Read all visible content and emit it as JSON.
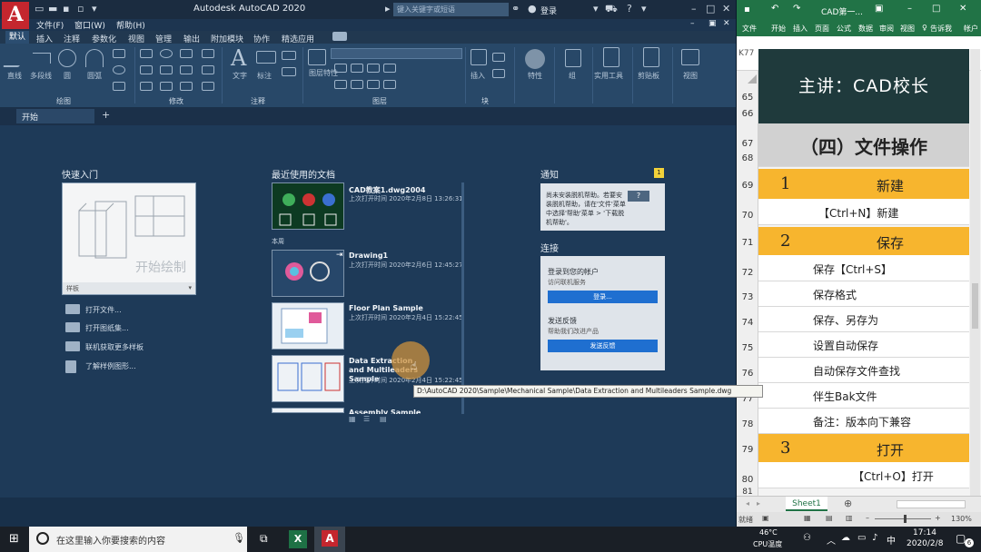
{
  "autocad": {
    "title": "Autodesk AutoCAD 2020",
    "search_placeholder": "键入关键字或短语",
    "login": "登录",
    "menus": [
      "文件(F)",
      "窗口(W)",
      "帮助(H)"
    ],
    "ribbon_tabs": [
      "默认",
      "插入",
      "注释",
      "参数化",
      "视图",
      "管理",
      "输出",
      "附加模块",
      "协作",
      "精选应用"
    ],
    "ribbon_panels": [
      "绘图",
      "修改",
      "注释",
      "图层",
      "块"
    ],
    "tools": [
      "直线",
      "多段线",
      "圆",
      "圆弧",
      "文字",
      "标注",
      "图层特性",
      "插入",
      "特性",
      "组",
      "实用工具",
      "剪贴板",
      "视图"
    ],
    "doc_tab": "开始",
    "quick_start": {
      "title": "快速入门",
      "template_caption": "开始绘制",
      "template_label": "样板",
      "links": [
        "打开文件...",
        "打开图纸集...",
        "联机获取更多样板",
        "了解样例图形..."
      ]
    },
    "recent": {
      "title": "最近使用的文档",
      "group_label": "本周",
      "items": [
        {
          "name": "CAD教案1.dwg2004",
          "time": "上次打开时间 2020年2月8日 13:26:31"
        },
        {
          "name": "Drawing1",
          "time": "上次打开时间 2020年2月6日 12:45:27"
        },
        {
          "name": "Floor Plan Sample",
          "time": "上次打开时间 2020年2月4日 15:22:45"
        },
        {
          "name": "Data Extraction and Multileaders Sample",
          "time": "上次打开时间 2020年2月4日 15:22:45"
        },
        {
          "name": "Assembly Sample",
          "time": ""
        }
      ]
    },
    "notify": {
      "title": "通知",
      "badge": "1",
      "text": "尚未安装脱机帮助。若要安装脱机帮助，请在'文件'菜单中选择'帮助'菜单 > '下载脱机帮助'。"
    },
    "connect": {
      "title": "连接",
      "signin_title": "登录到您的帐户",
      "signin_sub": "访问联机服务",
      "signin_btn": "登录...",
      "feedback_title": "发送反馈",
      "feedback_sub": "帮助我们改进产品",
      "feedback_btn": "发送反馈"
    },
    "tooltip": "D:\\AutoCAD 2020\\Sample\\Mechanical Sample\\Data Extraction and Multileaders Sample.dwg"
  },
  "excel": {
    "title": "CAD第一...",
    "ribbon_tabs": [
      "文件",
      "开始",
      "插入",
      "页面",
      "公式",
      "数据",
      "审阅",
      "视图",
      "告诉我",
      "帐户"
    ],
    "name_box": "K77",
    "banner": "主讲：CAD校长",
    "rows": [
      {
        "num": "65"
      },
      {
        "num": "66"
      },
      {
        "num": "67",
        "text": "（四）文件操作"
      },
      {
        "num": "68"
      },
      {
        "num": "69",
        "idx": "1",
        "text": "新建"
      },
      {
        "num": "70",
        "text": "【Ctrl+N】新建"
      },
      {
        "num": "71",
        "idx": "2",
        "text": "保存"
      },
      {
        "num": "72",
        "text": "保存【Ctrl+S】"
      },
      {
        "num": "73",
        "text": "保存格式"
      },
      {
        "num": "74",
        "text": "保存、另存为"
      },
      {
        "num": "75",
        "text": "设置自动保存"
      },
      {
        "num": "76",
        "text": "自动保存文件查找"
      },
      {
        "num": "77",
        "text": "伴生Bak文件"
      },
      {
        "num": "78",
        "text": "备注：版本向下兼容"
      },
      {
        "num": "79",
        "idx": "3",
        "text": "打开"
      },
      {
        "num": "80",
        "text": "【Ctrl+O】打开"
      },
      {
        "num": "81"
      }
    ],
    "sheet_tab": "Sheet1",
    "status_ready": "就绪",
    "zoom": "130%"
  },
  "taskbar": {
    "search_placeholder": "在这里输入你要搜索的内容",
    "temp": "46°C",
    "temp_label": "CPU温度",
    "time": "17:14",
    "date": "2020/2/8",
    "notif_count": "6"
  },
  "colors": {
    "autocad_bg": "#1e3a58",
    "excel_green": "#217346",
    "gold": "#f7b52e",
    "banner": "#1f3a3c"
  }
}
